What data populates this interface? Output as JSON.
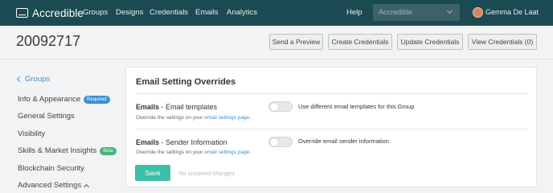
{
  "nav": {
    "brand": "Accredible",
    "links": [
      "Groups",
      "Designs",
      "Credentials",
      "Emails",
      "Analytics"
    ],
    "help": "Help",
    "org_selector": "Accredible",
    "user_name": "Gemma De Laat",
    "colors": {
      "background": "#1b4a52",
      "text": "#ffffff"
    }
  },
  "header": {
    "title": "20092717",
    "buttons": [
      "Send a Preview",
      "Create Credentials",
      "Update Credentials",
      "View Credentials (0)"
    ]
  },
  "sidebar": {
    "back_label": "Groups",
    "items": [
      {
        "label": "Info & Appearance",
        "badge": "Required"
      },
      {
        "label": "General Settings"
      },
      {
        "label": "Visibility"
      },
      {
        "label": "Skills & Market Insights",
        "badge": "Beta"
      },
      {
        "label": "Blockchain Security"
      },
      {
        "label": "Advanced Settings"
      }
    ]
  },
  "card": {
    "title": "Email Setting Overrides",
    "settings": [
      {
        "label_bold": "Emails",
        "label_rest": " - Email templates",
        "sub_prefix": "Override the settings on your ",
        "sub_link": "email settings page",
        "sub_suffix": ".",
        "toggle_label": "Use different email templates for this Group",
        "enabled": false
      },
      {
        "label_bold": "Emails",
        "label_rest": " - Sender Information",
        "sub_prefix": "Override the settings on your ",
        "sub_link": "email settings page",
        "sub_suffix": ".",
        "toggle_label": "Override email sender information",
        "enabled": false
      }
    ],
    "save_label": "Save",
    "save_status": "No unsaved changes",
    "accent_color": "#3dbfa8"
  }
}
